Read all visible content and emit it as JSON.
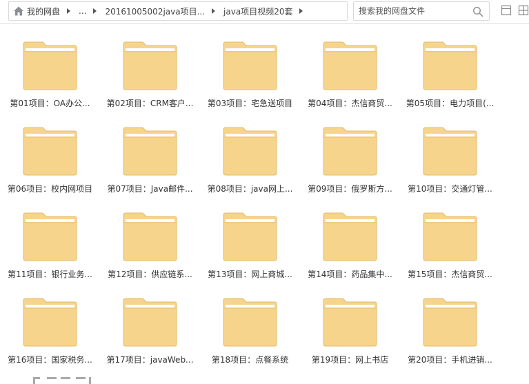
{
  "breadcrumb": {
    "home_label": "我的网盘",
    "ellipsis": "...",
    "parent_label": "20161005002java项目...",
    "current_label": "java项目视频20套"
  },
  "search": {
    "placeholder": "搜索我的网盘文件"
  },
  "folders": [
    {
      "label": "第01项目：OA办公..."
    },
    {
      "label": "第02项目：CRM客户..."
    },
    {
      "label": "第03项目：宅急送项目"
    },
    {
      "label": "第04项目：杰信商贸..."
    },
    {
      "label": "第05项目：电力项目(..."
    },
    {
      "label": "第06项目：校内网项目"
    },
    {
      "label": "第07项目：Java邮件..."
    },
    {
      "label": "第08项目：java网上..."
    },
    {
      "label": "第09项目：俄罗斯方..."
    },
    {
      "label": "第10项目：交通灯管..."
    },
    {
      "label": "第11项目：银行业务..."
    },
    {
      "label": "第12项目：供应链系..."
    },
    {
      "label": "第13项目：网上商城..."
    },
    {
      "label": "第14项目：药品集中..."
    },
    {
      "label": "第15项目：杰信商贸..."
    },
    {
      "label": "第16项目：国家税务..."
    },
    {
      "label": "第17项目：javaWeb..."
    },
    {
      "label": "第18项目：点餐系统"
    },
    {
      "label": "第19项目：网上书店"
    },
    {
      "label": "第20项目：手机进销..."
    }
  ],
  "colors": {
    "folder_body": "#f6d48c",
    "folder_edge": "#e3bd6b",
    "folder_stripe": "#ffffff",
    "icon_gray": "#9a9a9a"
  }
}
